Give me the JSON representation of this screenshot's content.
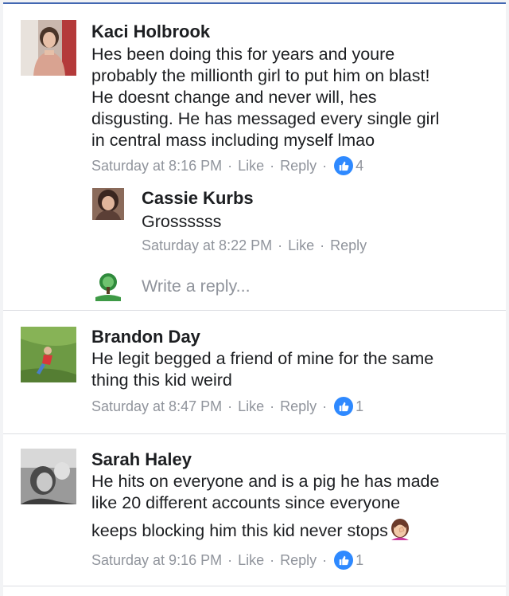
{
  "comments": [
    {
      "author": "Kaci Holbrook",
      "text_lines": [
        "Hes been doing this for years and youre",
        "probably the millionth girl to put him on blast!",
        "He doesnt change and never will, hes",
        "disgusting. He has messaged every single girl",
        "in central mass including myself lmao"
      ],
      "timestamp": "Saturday at 8:16 PM",
      "like_label": "Like",
      "reply_label": "Reply",
      "reaction_count": "4",
      "replies": [
        {
          "author": "Cassie Kurbs",
          "text": "Grossssss",
          "timestamp": "Saturday at 8:22 PM",
          "like_label": "Like",
          "reply_label": "Reply"
        }
      ],
      "write_reply_placeholder": "Write a reply..."
    },
    {
      "author": "Brandon Day",
      "text_lines": [
        "He legit begged a friend of mine for the same",
        "thing this kid weird"
      ],
      "timestamp": "Saturday at 8:47 PM",
      "like_label": "Like",
      "reply_label": "Reply",
      "reaction_count": "1"
    },
    {
      "author": "Sarah Haley",
      "text_lines": [
        "He hits on everyone and is a pig he has made",
        "like 20 different accounts since everyone",
        "keeps blocking him this kid never stops"
      ],
      "trailing_emoji": "woman-facepalming-emoji",
      "timestamp": "Saturday at 9:16 PM",
      "like_label": "Like",
      "reply_label": "Reply",
      "reaction_count": "1"
    }
  ],
  "meta_separator": "·",
  "colors": {
    "name": "#1c1e21",
    "meta": "#90949c",
    "like_badge": "#2e89ff",
    "divider": "#dcdee3",
    "top_accent": "#4267b2"
  }
}
